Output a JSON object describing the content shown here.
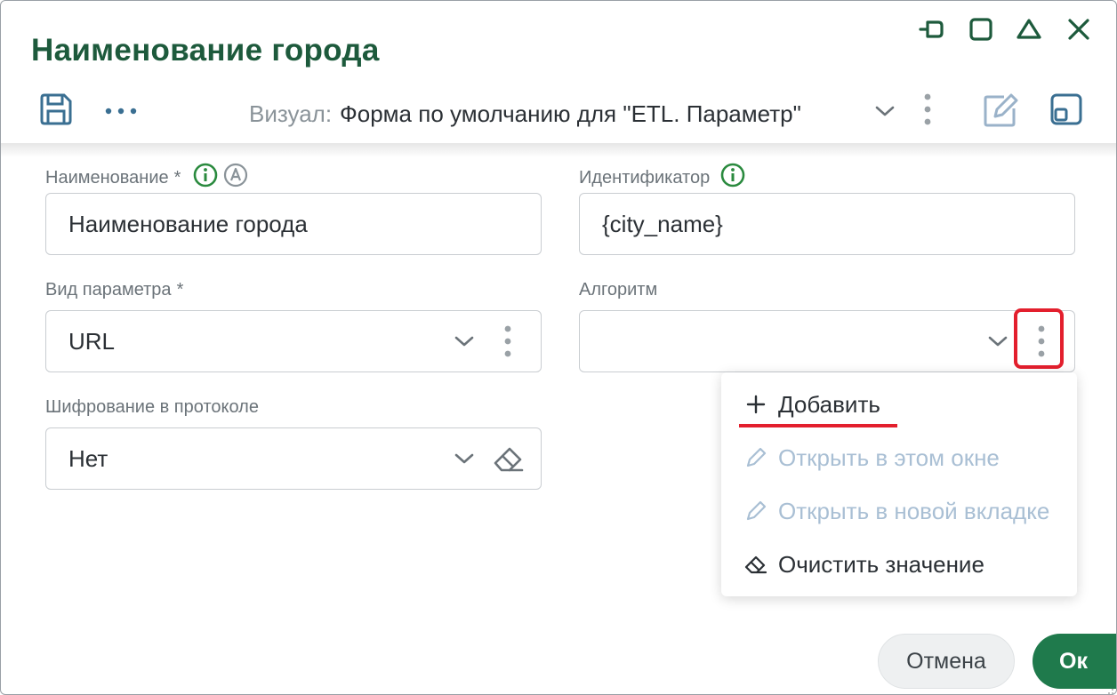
{
  "window": {
    "title": "Наименование города"
  },
  "toolbar": {
    "visual_label": "Визуал:",
    "visual_value": "Форма по умолчанию для \"ETL. Параметр\""
  },
  "fields": {
    "name": {
      "label": "Наименование",
      "required": "*",
      "value": "Наименование города"
    },
    "identifier": {
      "label": "Идентификатор",
      "value": "{city_name}"
    },
    "param_type": {
      "label": "Вид параметра",
      "required": "*",
      "value": "URL"
    },
    "algorithm": {
      "label": "Алгоритм",
      "value": ""
    },
    "encryption": {
      "label": "Шифрование в протоколе",
      "value": "Нет"
    }
  },
  "menu": {
    "items": [
      {
        "label": "Добавить",
        "icon": "plus-icon",
        "enabled": true
      },
      {
        "label": "Открыть в этом окне",
        "icon": "pencil-icon",
        "enabled": false
      },
      {
        "label": "Открыть в новой вкладке",
        "icon": "pencil-icon",
        "enabled": false
      },
      {
        "label": "Очистить значение",
        "icon": "eraser-icon",
        "enabled": true
      }
    ]
  },
  "footer": {
    "cancel_label": "Отмена",
    "ok_label": "Ок"
  },
  "colors": {
    "title": "#1d5a3c",
    "info_green": "#2a8a3e",
    "ok_button": "#1f7a4c",
    "highlight_red": "#e31f2d",
    "disabled_text": "#a9bfd4"
  }
}
